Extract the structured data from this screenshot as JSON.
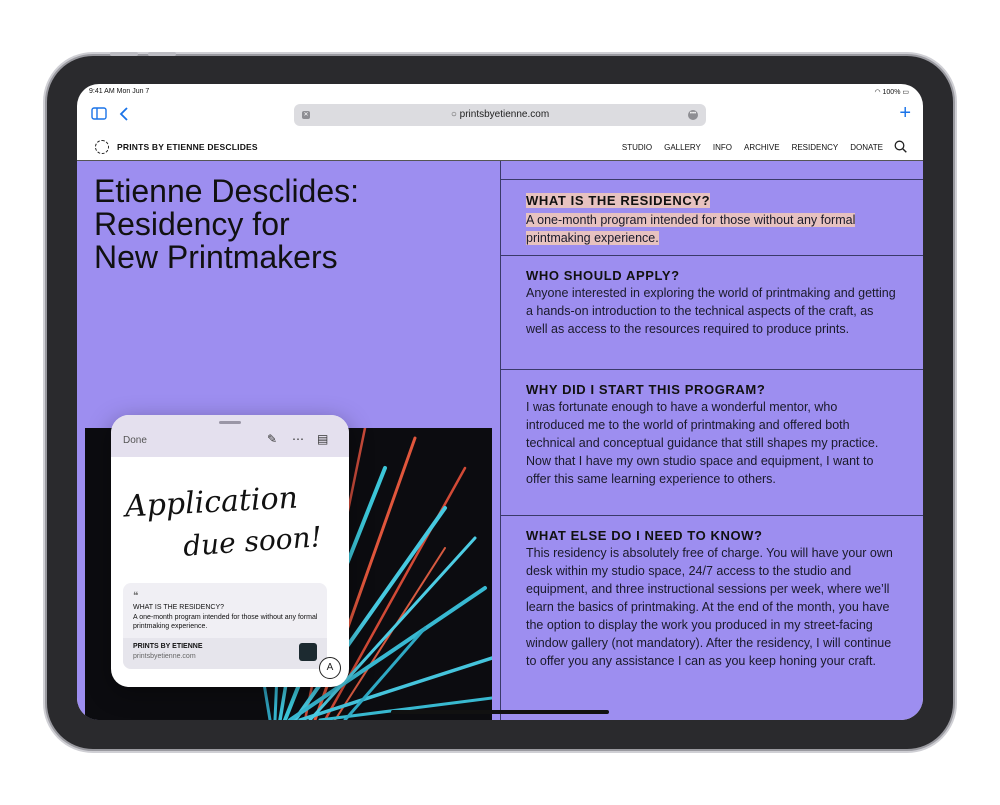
{
  "status_bar": {
    "time_date": "9:41 AM  Mon Jun 7",
    "battery": "100%"
  },
  "browser": {
    "url": "printsbyetienne.com",
    "icons": {
      "sidebar": "sidebar-icon",
      "back": "chevron-left-icon",
      "new_tab": "plus-icon",
      "more": "ellipsis-icon"
    }
  },
  "site": {
    "brand": "PRINTS BY ETIENNE DESCLIDES",
    "nav": [
      "STUDIO",
      "GALLERY",
      "INFO",
      "ARCHIVE",
      "RESIDENCY",
      "DONATE"
    ]
  },
  "page": {
    "title_lines": [
      "Etienne Desclides:",
      "Residency for",
      "New Printmakers"
    ],
    "qa": [
      {
        "q": "WHAT IS THE RESIDENCY?",
        "a": "A one-month program intended for those without any formal printmaking experience."
      },
      {
        "q": "WHO SHOULD APPLY?",
        "a": "Anyone interested in exploring the world of printmaking and getting a hands-on introduction to the technical aspects of the craft, as well as access to the resources required to produce prints."
      },
      {
        "q": "WHY DID I START THIS PROGRAM?",
        "a": "I was fortunate enough to have a wonderful mentor, who introduced me to the world of printmaking and offered both technical and conceptual guidance that still shapes my practice. Now that I have my own studio space and equipment, I want to offer this same learning experience to others."
      },
      {
        "q": "WHAT ELSE DO I NEED TO KNOW?",
        "a": "This residency is absolutely free of charge. You will have your own desk within my studio space, 24/7 access to the studio and equipment, and three instructional sessions per week, where we’ll learn the basics of printmaking. At the end of the month, you have the option to display the work you produced in my street-facing window gallery (not mandatory). After the residency, I will continue to offer you any assistance I can as you keep honing your craft."
      }
    ]
  },
  "quick_note": {
    "done_label": "Done",
    "handwriting_line1": "Application",
    "handwriting_line2": "due soon!",
    "card_quote_mark": "❝",
    "card_title": "WHAT IS THE RESIDENCY?",
    "card_text": "A one-month program intended for those without any formal printmaking experience.",
    "card_source_title": "PRINTS BY ETIENNE",
    "card_source_url": "printsbyetienne.com"
  }
}
